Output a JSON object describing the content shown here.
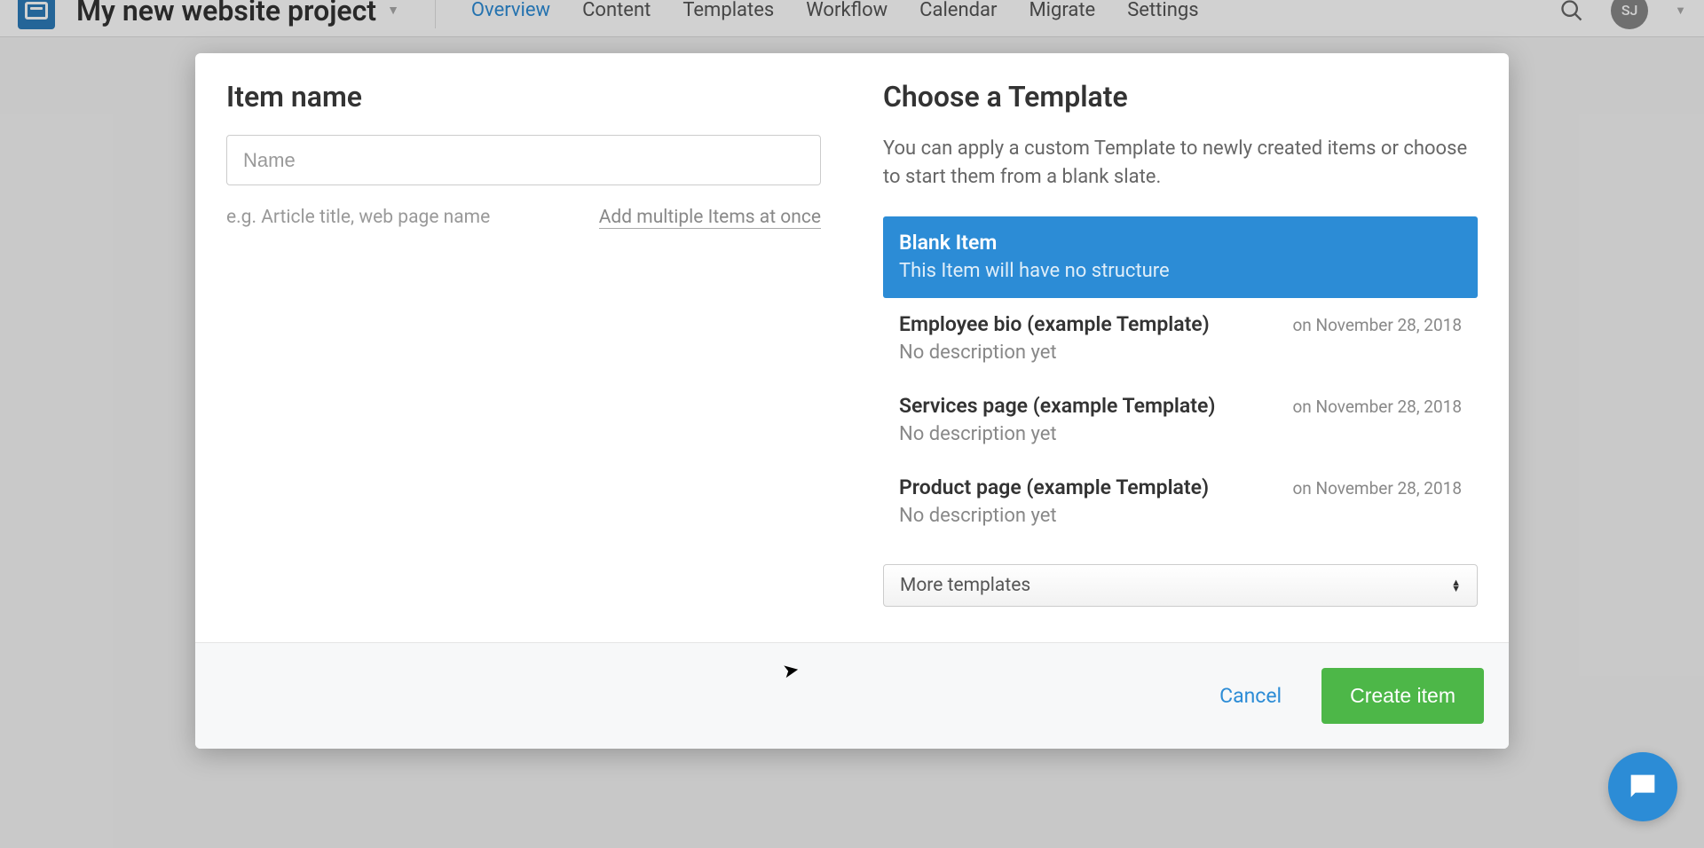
{
  "header": {
    "project_title": "My new website project",
    "nav": {
      "overview": "Overview",
      "content": "Content",
      "templates": "Templates",
      "workflow": "Workflow",
      "calendar": "Calendar",
      "migrate": "Migrate",
      "settings": "Settings"
    },
    "user_initials": "SJ"
  },
  "modal": {
    "left": {
      "title": "Item name",
      "name_placeholder": "Name",
      "hint": "e.g. Article title, web page name",
      "multi_link": "Add multiple Items at once"
    },
    "right": {
      "title": "Choose a Template",
      "description": "You can apply a custom Template to newly created items or choose to start them from a blank slate.",
      "templates": [
        {
          "name": "Blank Item",
          "sub": "This Item will have no structure",
          "date": "",
          "selected": true
        },
        {
          "name": "Employee bio (example Template)",
          "sub": "No description yet",
          "date": "on November 28, 2018",
          "selected": false
        },
        {
          "name": "Services page (example Template)",
          "sub": "No description yet",
          "date": "on November 28, 2018",
          "selected": false
        },
        {
          "name": "Product page (example Template)",
          "sub": "No description yet",
          "date": "on November 28, 2018",
          "selected": false
        }
      ],
      "more_label": "More templates"
    },
    "footer": {
      "cancel": "Cancel",
      "create": "Create item"
    }
  }
}
